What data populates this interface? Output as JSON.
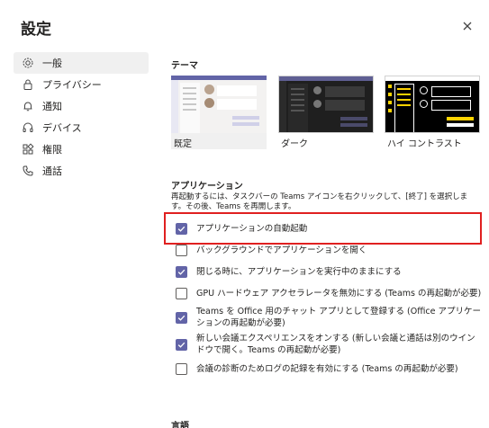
{
  "dialog": {
    "title": "設定"
  },
  "sidebar": {
    "items": [
      {
        "label": "一般",
        "icon": "gear-icon",
        "active": true
      },
      {
        "label": "プライバシー",
        "icon": "lock-icon"
      },
      {
        "label": "通知",
        "icon": "bell-icon"
      },
      {
        "label": "デバイス",
        "icon": "headset-icon"
      },
      {
        "label": "権限",
        "icon": "apps-icon"
      },
      {
        "label": "通話",
        "icon": "phone-icon"
      }
    ]
  },
  "theme": {
    "heading": "テーマ",
    "options": [
      {
        "label": "既定",
        "selected": true
      },
      {
        "label": "ダーク"
      },
      {
        "label": "ハイ コントラスト"
      }
    ]
  },
  "application": {
    "heading": "アプリケーション",
    "description": "再起動するには、タスクバーの Teams アイコンを右クリックして、[終了] を選択します。その後、Teams を再開します。",
    "options": [
      {
        "label": "アプリケーションの自動起動",
        "checked": true
      },
      {
        "label": "バックグラウンドでアプリケーションを開く",
        "checked": false
      },
      {
        "label": "閉じる時に、アプリケーションを実行中のままにする",
        "checked": true
      },
      {
        "label": "GPU ハードウェア アクセラレータを無効にする (Teams の再起動が必要)",
        "checked": false
      },
      {
        "label": "Teams を Office 用のチャット アプリとして登録する (Office アプリケーションの再起動が必要)",
        "checked": true
      },
      {
        "label": "新しい会議エクスペリエンスをオンする (新しい会議と通話は別のウインドウで開く。Teams の再起動が必要)",
        "checked": true
      },
      {
        "label": "会議の診断のためログの記録を有効にする (Teams の再起動が必要)",
        "checked": false
      }
    ]
  },
  "next_section": {
    "heading": "言語"
  },
  "colors": {
    "accent": "#6264a7",
    "highlight": "#e02020"
  }
}
